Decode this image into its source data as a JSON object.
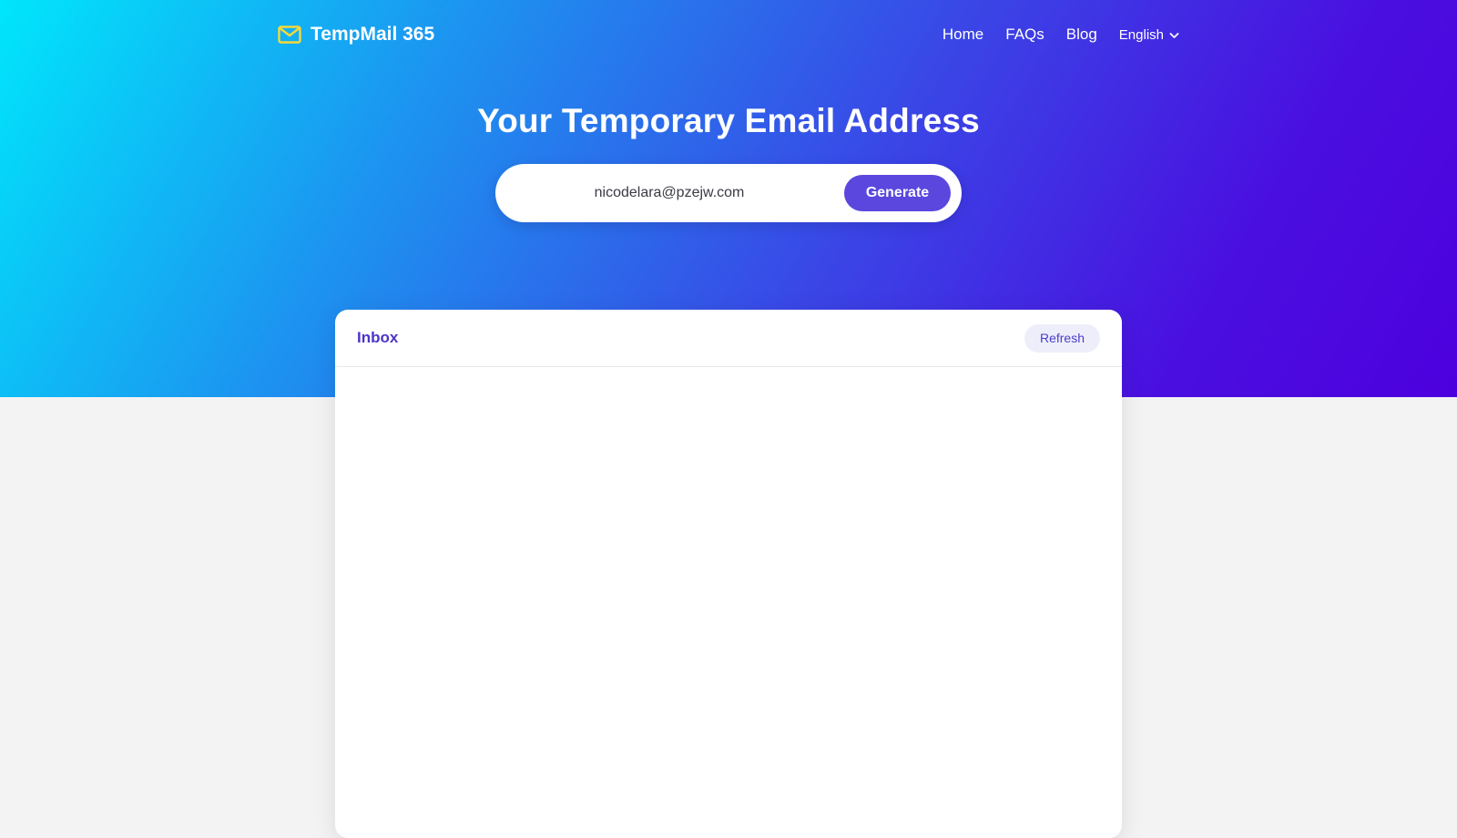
{
  "header": {
    "brand": "TempMail 365",
    "brand_icon": "mail-icon",
    "brand_icon_color": "#f5d93a",
    "nav": [
      {
        "label": "Home"
      },
      {
        "label": "FAQs"
      },
      {
        "label": "Blog"
      }
    ],
    "language": {
      "selected": "English",
      "icon": "chevron-down-icon"
    }
  },
  "hero": {
    "title": "Your Temporary Email Address",
    "email": "nicodelara@pzejw.com",
    "generate_label": "Generate"
  },
  "inbox": {
    "title": "Inbox",
    "refresh_label": "Refresh"
  },
  "colors": {
    "gradient_start": "#00e6fb",
    "gradient_end": "#4d00de",
    "accent": "#5b47de",
    "inbox_title": "#4a35c8",
    "page_background": "#f3f3f4"
  }
}
